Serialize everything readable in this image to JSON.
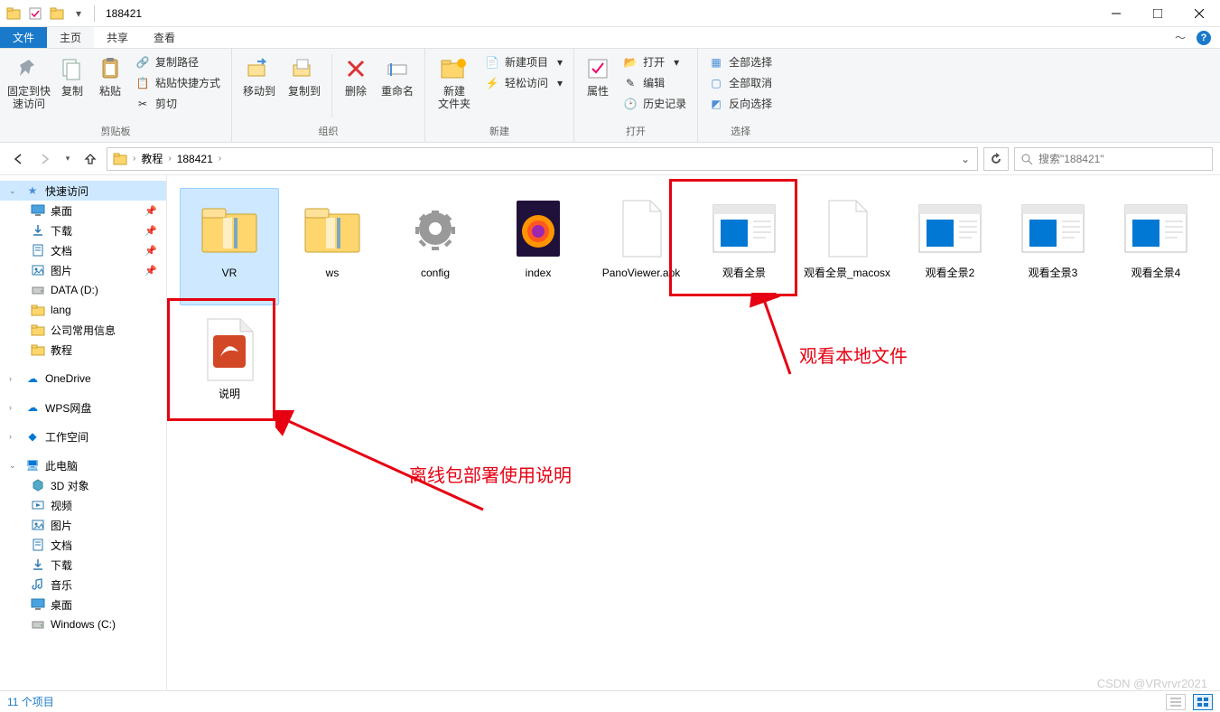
{
  "window": {
    "title": "188421"
  },
  "tabs": {
    "file": "文件",
    "home": "主页",
    "share": "共享",
    "view": "查看"
  },
  "ribbon": {
    "clipboard": {
      "pin": "固定到快\n速访问",
      "copy": "复制",
      "paste": "粘贴",
      "copyPath": "复制路径",
      "pasteShortcut": "粘贴快捷方式",
      "cut": "剪切",
      "label": "剪贴板"
    },
    "organize": {
      "moveTo": "移动到",
      "copyTo": "复制到",
      "delete": "删除",
      "rename": "重命名",
      "label": "组织"
    },
    "new": {
      "newFolder": "新建\n文件夹",
      "newItem": "新建项目",
      "easyAccess": "轻松访问",
      "label": "新建"
    },
    "open": {
      "properties": "属性",
      "open": "打开",
      "edit": "编辑",
      "history": "历史记录",
      "label": "打开"
    },
    "select": {
      "selectAll": "全部选择",
      "selectNone": "全部取消",
      "invert": "反向选择",
      "label": "选择"
    }
  },
  "breadcrumb": {
    "items": [
      "教程",
      "188421"
    ]
  },
  "search": {
    "placeholder": "搜索\"188421\""
  },
  "sidebar": {
    "quickAccess": "快速访问",
    "items1": [
      {
        "name": "桌面",
        "icon": "desktop",
        "pinned": true
      },
      {
        "name": "下载",
        "icon": "download",
        "pinned": true
      },
      {
        "name": "文档",
        "icon": "document",
        "pinned": true
      },
      {
        "name": "图片",
        "icon": "picture",
        "pinned": true
      },
      {
        "name": "DATA (D:)",
        "icon": "drive",
        "pinned": false
      },
      {
        "name": "lang",
        "icon": "folder",
        "pinned": false
      },
      {
        "name": "公司常用信息",
        "icon": "folder",
        "pinned": false
      },
      {
        "name": "教程",
        "icon": "folder",
        "pinned": false
      }
    ],
    "oneDrive": "OneDrive",
    "wps": "WPS网盘",
    "workspace": "工作空间",
    "thisPc": "此电脑",
    "items2": [
      {
        "name": "3D 对象",
        "icon": "3d"
      },
      {
        "name": "视频",
        "icon": "video"
      },
      {
        "name": "图片",
        "icon": "picture"
      },
      {
        "name": "文档",
        "icon": "document"
      },
      {
        "name": "下载",
        "icon": "download"
      },
      {
        "name": "音乐",
        "icon": "music"
      },
      {
        "name": "桌面",
        "icon": "desktop"
      },
      {
        "name": "Windows (C:)",
        "icon": "drive"
      }
    ]
  },
  "files": [
    {
      "name": "VR",
      "type": "folder",
      "selected": true
    },
    {
      "name": "ws",
      "type": "folder"
    },
    {
      "name": "config",
      "type": "config"
    },
    {
      "name": "index",
      "type": "firefox"
    },
    {
      "name": "PanoViewer.apk",
      "type": "blank"
    },
    {
      "name": "观看全景",
      "type": "hta"
    },
    {
      "name": "观看全景_macosx",
      "type": "blank"
    },
    {
      "name": "观看全景2",
      "type": "hta"
    },
    {
      "name": "观看全景3",
      "type": "hta"
    },
    {
      "name": "观看全景4",
      "type": "hta"
    },
    {
      "name": "说明",
      "type": "pdf"
    }
  ],
  "annotations": {
    "text1": "观看本地文件",
    "text2": "离线包部署使用说明"
  },
  "status": {
    "count": "11 个项目"
  },
  "watermark": "CSDN @VRvrvr2021"
}
